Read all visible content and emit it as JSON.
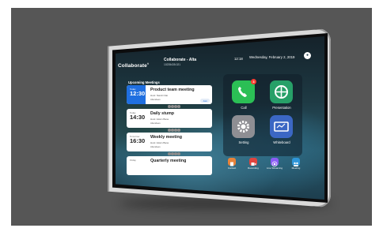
{
  "header": {
    "logo": "Collaborate",
    "logo_mark": "®",
    "room_name": "Collaborate - Alta",
    "room_id": "10235435.021",
    "time": "12:18",
    "date": "Wednesday, February 2, 2019",
    "user_icon": "user-icon"
  },
  "meetings": {
    "heading": "Upcoming Meetings",
    "items": [
      {
        "day": "Today",
        "time": "12:30",
        "title": "Product team meeting",
        "host": "Host: Nandi Otai",
        "attendees": "Attendees",
        "action": "Join",
        "active": true
      },
      {
        "day": "Today",
        "time": "14:30",
        "title": "Daily stump",
        "host": "Host: Adam Bane",
        "attendees": "Attendees",
        "active": false
      },
      {
        "day": "Tomorrow",
        "time": "16:30",
        "title": "Weekly meeting",
        "host": "Host: Adam Bane",
        "attendees": "Attendees",
        "active": false
      },
      {
        "day": "Friday",
        "time": "",
        "title": "Quarterly meeting",
        "host": "",
        "attendees": "",
        "active": false
      }
    ]
  },
  "actions": {
    "main": [
      {
        "label": "Call",
        "icon": "phone-icon",
        "color": "#2bbf55",
        "badge": "3"
      },
      {
        "label": "Presentation",
        "icon": "presentation-icon",
        "color": "#27a068"
      },
      {
        "label": "Setting",
        "icon": "gear-icon",
        "color": "#8e8e93"
      },
      {
        "label": "Whiteboard",
        "icon": "whiteboard-icon",
        "color": "#3b67c4"
      }
    ],
    "secondary": [
      {
        "label": "Contact",
        "icon": "contact-icon",
        "color": "#e8833a"
      },
      {
        "label": "Recording",
        "icon": "record-icon",
        "color": "#e0443e"
      },
      {
        "label": "Live Streaming",
        "icon": "live-streaming-icon",
        "color": "#8b5cf6"
      },
      {
        "label": "Meeting",
        "icon": "meeting-icon",
        "color": "#2f96d8"
      }
    ]
  }
}
